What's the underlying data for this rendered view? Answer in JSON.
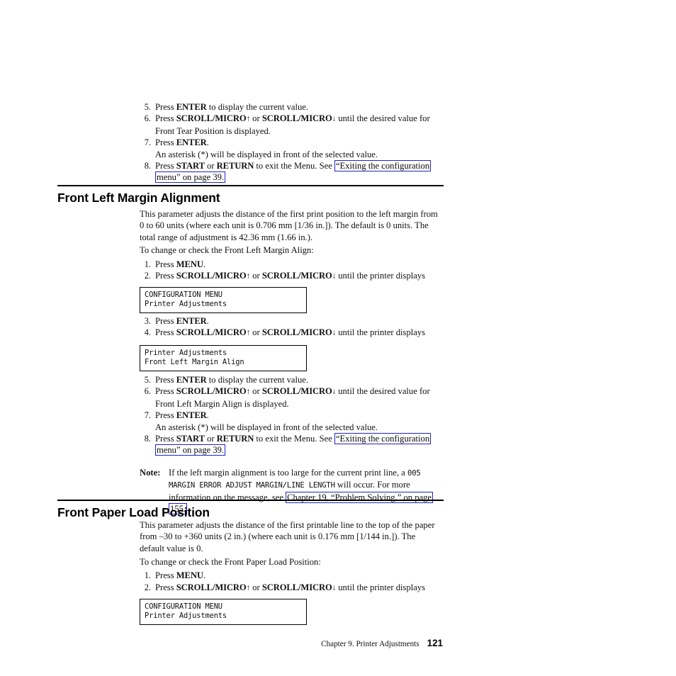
{
  "document": {
    "page_number": "121",
    "footer_chapter": "Chapter 9. Printer Adjustments"
  },
  "top_steps": {
    "items": [
      {
        "num": "5.",
        "text_pre": "Press ",
        "key": "ENTER",
        "text_post": " to display the current value."
      },
      {
        "num": "6.",
        "text_pre": "Press ",
        "key1": "SCROLL/MICRO",
        "arrow1": "↑",
        "mid": " or ",
        "key2": "SCROLL/MICRO",
        "arrow2": "↓",
        "text_post": " until the desired value for Front Tear Position is displayed."
      },
      {
        "num": "7.",
        "text_pre": "Press ",
        "key": "ENTER",
        "text_post": ".",
        "sub": "An asterisk (*) will be displayed in front of the selected value."
      },
      {
        "num": "8.",
        "text_pre": "Press ",
        "key1": "START",
        "mid": " or ",
        "key2": "RETURN",
        "text_mid": " to exit the Menu. See ",
        "link": "“Exiting the configuration menu” on page 39.",
        "text_end": ""
      }
    ]
  },
  "section_margin": {
    "heading": "Front Left Margin Alignment",
    "intro": "This parameter adjusts the distance of the first print position to the left margin from 0 to 60 units (where each unit is 0.706 mm [1/36 in.]). The default is 0 units. The total range of adjustment is 42.36 mm (1.66 in.).",
    "lead_in": "To change or check the Front Left Margin Align:",
    "steps": [
      {
        "num": "1.",
        "text_pre": "Press ",
        "key": "MENU",
        "text_post": "."
      },
      {
        "num": "2.",
        "text_pre": "Press ",
        "key1": "SCROLL/MICRO",
        "arrow1": "↑",
        "mid": " or ",
        "key2": "SCROLL/MICRO",
        "arrow2": "↓",
        "text_post": " until the printer displays"
      },
      {
        "num": "3.",
        "text_pre": "Press ",
        "key": "ENTER",
        "text_post": "."
      },
      {
        "num": "4.",
        "text_pre": "Press ",
        "key1": "SCROLL/MICRO",
        "arrow1": "↑",
        "mid": " or ",
        "key2": "SCROLL/MICRO",
        "arrow2": "↓",
        "text_post": " until the printer displays"
      },
      {
        "num": "5.",
        "text_pre": "Press ",
        "key": "ENTER",
        "text_post": " to display the current value."
      },
      {
        "num": "6.",
        "text_pre": "Press ",
        "key1": "SCROLL/MICRO",
        "arrow1": "↑",
        "mid": " or ",
        "key2": "SCROLL/MICRO",
        "arrow2": "↓",
        "text_post": " until the desired value for Front Left Margin Align is displayed."
      },
      {
        "num": "7.",
        "text_pre": "Press ",
        "key": "ENTER",
        "text_post": ".",
        "sub": "An asterisk (*) will be displayed in front of the selected value."
      },
      {
        "num": "8.",
        "text_pre": "Press ",
        "key1": "START",
        "mid": " or ",
        "key2": "RETURN",
        "text_mid": " to exit the Menu. See ",
        "link": "“Exiting the configuration menu” on page 39."
      }
    ],
    "lcd_1": {
      "line1": "CONFIGURATION MENU",
      "line2": "Printer Adjustments"
    },
    "lcd_2": {
      "line1": "Printer Adjustments",
      "line2": "Front Left Margin Align"
    },
    "note": {
      "label": "Note:",
      "part1": "If the left margin alignment is too large for the current print line, a ",
      "mono1": "005 MARGIN ERROR ADJUST MARGIN/LINE LENGTH",
      "part2": " will occur. For more information on the message, see ",
      "link": "Chapter 19, “Problem Solving,” on page 155."
    }
  },
  "section_paper": {
    "heading": "Front Paper Load Position",
    "intro": "This parameter adjusts the distance of the first printable line to the top of the paper from –30 to +360 units (2 in.) (where each unit is 0.176 mm [1/144 in.]). The default value is 0.",
    "lead_in": "To change or check the Front Paper Load Position:",
    "steps": [
      {
        "num": "1.",
        "text_pre": "Press ",
        "key": "MENU",
        "text_post": "."
      },
      {
        "num": "2.",
        "text_pre": "Press ",
        "key1": "SCROLL/MICRO",
        "arrow1": "↑",
        "mid": " or ",
        "key2": "SCROLL/MICRO",
        "arrow2": "↓",
        "text_post": " until the printer displays"
      }
    ],
    "lcd_1": {
      "line1": "CONFIGURATION MENU",
      "line2": "Printer Adjustments"
    }
  }
}
